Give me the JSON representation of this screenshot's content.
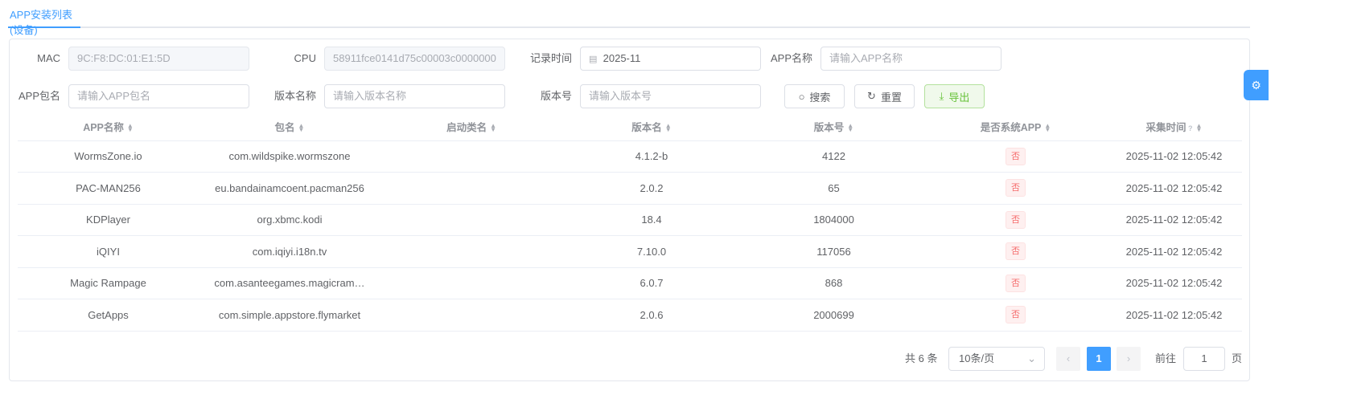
{
  "tab": {
    "title": "APP安装列表(设备)"
  },
  "filters": {
    "mac": {
      "label": "MAC",
      "value": "9C:F8:DC:01:E1:5D"
    },
    "cpu": {
      "label": "CPU",
      "value": "58911fce0141d75c00003c0000000"
    },
    "record_time": {
      "label": "记录时间",
      "value": "2025-11"
    },
    "app_name": {
      "label": "APP名称",
      "placeholder": "请输入APP名称"
    },
    "app_package": {
      "label": "APP包名",
      "placeholder": "请输入APP包名"
    },
    "version_name": {
      "label": "版本名称",
      "placeholder": "请输入版本名称"
    },
    "version_code": {
      "label": "版本号",
      "placeholder": "请输入版本号"
    }
  },
  "buttons": {
    "search": "搜索",
    "reset": "重置",
    "export": "导出"
  },
  "table": {
    "columns": [
      "APP名称",
      "包名",
      "启动类名",
      "版本名",
      "版本号",
      "是否系统APP",
      "采集时间"
    ],
    "rows": [
      [
        "WormsZone.io",
        "com.wildspike.wormszone",
        "",
        "4.1.2-b",
        "4122",
        "否",
        "2025-11-02 12:05:42"
      ],
      [
        "PAC-MAN256",
        "eu.bandainamcoent.pacman256",
        "",
        "2.0.2",
        "65",
        "否",
        "2025-11-02 12:05:42"
      ],
      [
        "KDPlayer",
        "org.xbmc.kodi",
        "",
        "18.4",
        "1804000",
        "否",
        "2025-11-02 12:05:42"
      ],
      [
        "iQIYI",
        "com.iqiyi.i18n.tv",
        "",
        "7.10.0",
        "117056",
        "否",
        "2025-11-02 12:05:42"
      ],
      [
        "Magic Rampage",
        "com.asanteegames.magicram…",
        "",
        "6.0.7",
        "868",
        "否",
        "2025-11-02 12:05:42"
      ],
      [
        "GetApps",
        "com.simple.appstore.flymarket",
        "",
        "2.0.6",
        "2000699",
        "否",
        "2025-11-02 12:05:42"
      ]
    ]
  },
  "pagination": {
    "total": "共 6 条",
    "page_size": "10条/页",
    "current": "1",
    "goto_label": "前往",
    "goto_value": "1",
    "page_suffix": "页"
  },
  "colors": {
    "primary": "#409eff",
    "danger": "#f56c6c",
    "success": "#67c23a"
  }
}
